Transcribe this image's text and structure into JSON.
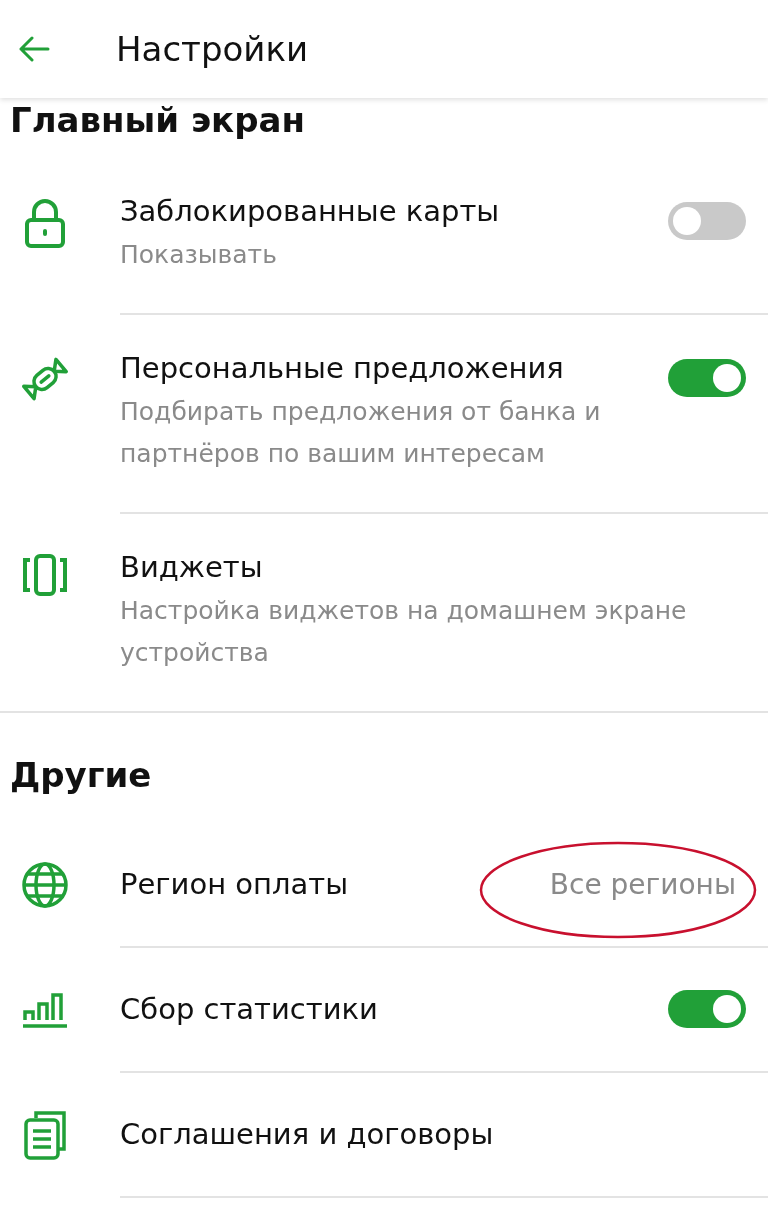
{
  "header": {
    "title": "Настройки"
  },
  "sections": [
    {
      "title": "Главный экран",
      "items": [
        {
          "kind": "toggle",
          "title": "Заблокированные карты",
          "subtitle": "Показывать",
          "on": false
        },
        {
          "kind": "toggle",
          "title": "Персональные предложения",
          "subtitle": "Подбирать предложения от банка и партнёров по вашим интересам",
          "on": true
        },
        {
          "kind": "link",
          "title": "Виджеты",
          "subtitle": "Настройка виджетов на домашнем экране устройства"
        }
      ]
    },
    {
      "title": "Другие",
      "items": [
        {
          "kind": "value",
          "title": "Регион оплаты",
          "value": "Все регионы"
        },
        {
          "kind": "toggle",
          "title": "Сбор статистики",
          "on": true
        },
        {
          "kind": "link",
          "title": "Соглашения и договоры"
        }
      ]
    }
  ]
}
